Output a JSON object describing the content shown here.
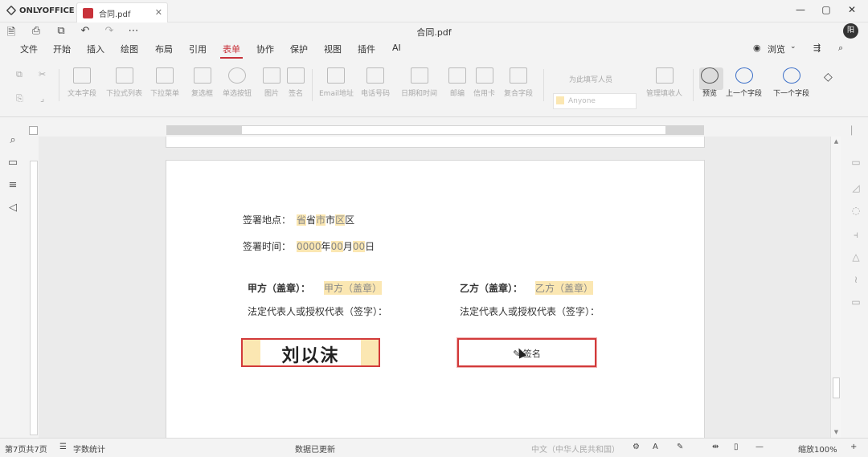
{
  "app": {
    "name": "ONLYOFFICE"
  },
  "tab": {
    "title": "合同.pdf"
  },
  "window": {
    "minimize": "—",
    "restore": "▢",
    "close": "✕"
  },
  "quick_access": {
    "doc_title": "合同.pdf",
    "avatar": "阳"
  },
  "menu": {
    "items": [
      "文件",
      "开始",
      "插入",
      "绘图",
      "布局",
      "引用",
      "表单",
      "协作",
      "保护",
      "视图",
      "插件",
      "AI"
    ],
    "active": "表单",
    "view_mode": "浏览"
  },
  "toolbar": {
    "buttons": [
      "文本字段",
      "下拉式列表",
      "下拉菜单",
      "复选框",
      "单选按钮",
      "图片",
      "签名"
    ],
    "buttons2": [
      "Email地址",
      "电话号码",
      "日期和时间",
      "邮编",
      "信用卡",
      "复合字段"
    ],
    "role_label": "为此填写人员",
    "role_value": "Anyone",
    "manage_roles": "管理填收人",
    "preview": "预览",
    "prev_field": "上一个字段",
    "next_field": "下一个字段"
  },
  "document": {
    "place_label": "签署地点：",
    "place_fields": [
      "省",
      "省",
      "市",
      "市",
      "区",
      "区"
    ],
    "time_label": "签署时间：",
    "time_fields": [
      "0000",
      "年",
      "00",
      "月",
      "00",
      "日"
    ],
    "party_a_label": "甲方（盖章）：",
    "party_a_field": "甲方（盖章）",
    "party_b_label": "乙方（盖章）：",
    "party_b_field": "乙方（盖章）",
    "rep_a": "法定代表人或授权代表（签字）：",
    "rep_b": "法定代表人或授权代表（签字）：",
    "signature_a": "刘以沫",
    "signature_b": "签名"
  },
  "status": {
    "page": "第7页共7页",
    "word_count": "字数统计",
    "status_msg": "数据已更新",
    "language": "中文（中华人民共和国）",
    "zoom": "缩放100%"
  },
  "colors": {
    "accent": "#c8323a",
    "field_fill": "#fbe7b2",
    "sig_border": "#d23a3a"
  }
}
